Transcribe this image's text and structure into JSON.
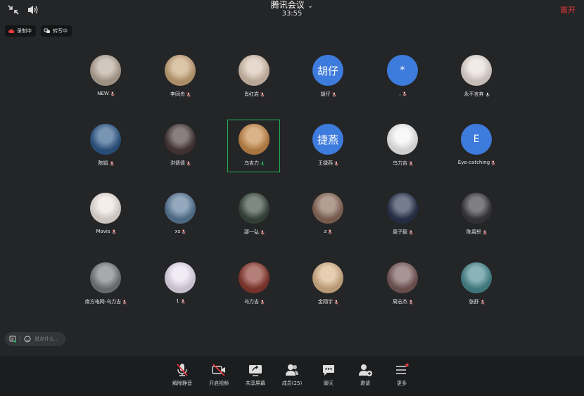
{
  "header": {
    "title": "腾讯会议",
    "timer": "33:55",
    "leave_label": "离开"
  },
  "badges": {
    "recording": "录制中",
    "transcribing": "转写中"
  },
  "participants": [
    {
      "name": "NEW",
      "color": "#b9aa9a"
    },
    {
      "name": "李同舟",
      "color": "#c9a77a"
    },
    {
      "name": "肖红岩",
      "color": "#d8c3b0"
    },
    {
      "name": "胡仔",
      "initial": "胡仔",
      "color": "#3d7bdc"
    },
    {
      "name": ",",
      "initial": "*",
      "color": "#3d7bdc"
    },
    {
      "name": "永不言弃",
      "color": "#e9ded8"
    },
    {
      "name": "陈娟",
      "color": "#2f5a8a"
    },
    {
      "name": "洪倩倩",
      "color": "#4a3a3a"
    },
    {
      "name": "乌吉力",
      "color": "#c88b4a"
    },
    {
      "name": "王捷燕",
      "initial": "捷燕",
      "color": "#3d7bdc"
    },
    {
      "name": "乌力吉",
      "color": "#f4f4f4"
    },
    {
      "name": "Eye-catching",
      "initial": "E",
      "color": "#3d7bdc"
    },
    {
      "name": "Mavis",
      "color": "#efe6e0"
    },
    {
      "name": "xs",
      "color": "#5a7a9a"
    },
    {
      "name": "邵一弘",
      "color": "#3a4a40"
    },
    {
      "name": "z",
      "color": "#8a6a5a"
    },
    {
      "name": "周子毅",
      "color": "#2a3550"
    },
    {
      "name": "陈禹轩",
      "color": "#3a3a40"
    },
    {
      "name": "南方电网-乌力吉",
      "color": "#777c80"
    },
    {
      "name": "1",
      "color": "#eae0f0"
    },
    {
      "name": "乌力吉",
      "color": "#8a3a30"
    },
    {
      "name": "金翔宇",
      "color": "#d9b48a"
    },
    {
      "name": "周志杰",
      "color": "#7a5a5a"
    },
    {
      "name": "张舒",
      "color": "#4a8a90"
    }
  ],
  "chat": {
    "placeholder": "说点什么..."
  },
  "toolbar": [
    {
      "label": "解除静音",
      "icon": "mic-muted-icon"
    },
    {
      "label": "开启视频",
      "icon": "video-off-icon"
    },
    {
      "label": "共享屏幕",
      "icon": "share-screen-icon"
    },
    {
      "label": "成员(25)",
      "icon": "members-icon"
    },
    {
      "label": "聊天",
      "icon": "chat-icon"
    },
    {
      "label": "邀请",
      "icon": "invite-icon"
    },
    {
      "label": "更多",
      "icon": "more-icon"
    }
  ],
  "colors": {
    "leave": "#e63a3a",
    "active_speaker": "#1fb35a",
    "avatar_blue": "#3d7bdc"
  }
}
